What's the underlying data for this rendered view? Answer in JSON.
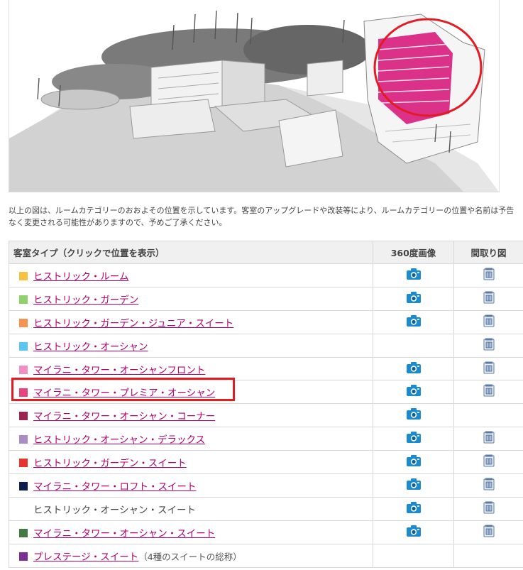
{
  "note": "以上の図は、ルームカテゴリーのおおよその位置を示しています。客室のアップグレードや改装等により、ルームカテゴリーの位置や名前は予告なく変更される可能性がありますので、予めご了承ください。",
  "table": {
    "headers": [
      "客室タイプ（クリックで位置を表示）",
      "360度画像",
      "間取り図"
    ],
    "rows": [
      {
        "color": "#f9c23c",
        "name": "ヒストリック・ルーム",
        "link": true,
        "note": "",
        "has360": true,
        "hasPlan": true
      },
      {
        "color": "#8fd16a",
        "name": "ヒストリック・ガーデン",
        "link": true,
        "note": "",
        "has360": true,
        "hasPlan": true
      },
      {
        "color": "#f7934f",
        "name": "ヒストリック・ガーデン・ジュニア・スイート",
        "link": true,
        "note": "",
        "has360": true,
        "hasPlan": true
      },
      {
        "color": "#5cc6f2",
        "name": "ヒストリック・オーシャン",
        "link": true,
        "note": "",
        "has360": false,
        "hasPlan": true
      },
      {
        "color": "#f28fc0",
        "name": "マイラニ・タワー・オーシャンフロント",
        "link": true,
        "note": "",
        "has360": true,
        "hasPlan": true
      },
      {
        "color": "#e8437d",
        "name": "マイラニ・タワー・プレミア・オーシャン",
        "link": true,
        "note": "",
        "has360": true,
        "hasPlan": true
      },
      {
        "color": "#a0214f",
        "name": "マイラニ・タワー・オーシャン・コーナー",
        "link": true,
        "note": "",
        "has360": true,
        "hasPlan": false
      },
      {
        "color": "#a98bc6",
        "name": "ヒストリック・オーシャン・デラックス",
        "link": true,
        "note": "",
        "has360": true,
        "hasPlan": true
      },
      {
        "color": "#e8332a",
        "name": "ヒストリック・ガーデン・スイート",
        "link": true,
        "note": "",
        "has360": true,
        "hasPlan": true
      },
      {
        "color": "#0d1f4f",
        "name": "マイラニ・タワー・ロフト・スイート",
        "link": true,
        "note": "",
        "has360": true,
        "hasPlan": true
      },
      {
        "color": "",
        "name": "ヒストリック・オーシャン・スイート",
        "link": false,
        "note": "",
        "has360": true,
        "hasPlan": true
      },
      {
        "color": "#3f7a3f",
        "name": "マイラニ・タワー・オーシャン・スイート",
        "link": true,
        "note": "",
        "has360": true,
        "hasPlan": true
      },
      {
        "color": "#7a2f95",
        "name": "プレステージ・スイート",
        "link": true,
        "note": "（4種のスイートの総称）",
        "has360": false,
        "hasPlan": false
      }
    ]
  },
  "colors": {
    "link": "#b5006b",
    "highlight": "#e31b23",
    "tower_highlight": "#d6006e"
  }
}
